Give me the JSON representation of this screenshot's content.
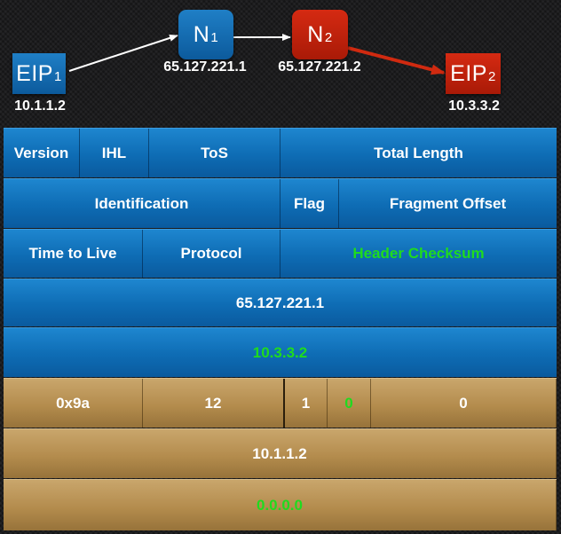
{
  "nodes": {
    "eip1": {
      "label": "EIP",
      "sub": "1",
      "addr": "10.1.1.2"
    },
    "n1": {
      "label": "N",
      "sub": "1",
      "addr": "65.127.221.1"
    },
    "n2": {
      "label": "N",
      "sub": "2",
      "addr": "65.127.221.2"
    },
    "eip2": {
      "label": "EIP",
      "sub": "2",
      "addr": "10.3.3.2"
    }
  },
  "colors": {
    "blue_header": "#0e6cb4",
    "gold_payload": "#b48c4d",
    "highlight_green": "#1fdb1f",
    "red_node": "#c42310",
    "blue_node": "#1171b8"
  },
  "ip_header": {
    "row1": [
      "Version",
      "IHL",
      "ToS",
      "Total Length"
    ],
    "row2": [
      "Identification",
      "Flag",
      "Fragment Offset"
    ],
    "row3": [
      "Time to Live",
      "Protocol",
      "Header Checksum"
    ],
    "source_address": "65.127.221.1",
    "destination_address": "10.3.3.2"
  },
  "inner_packet": {
    "row1": [
      "0x9a",
      "12",
      "1",
      "0",
      "0"
    ],
    "source_address": "10.1.1.2",
    "destination_address": "0.0.0.0"
  }
}
